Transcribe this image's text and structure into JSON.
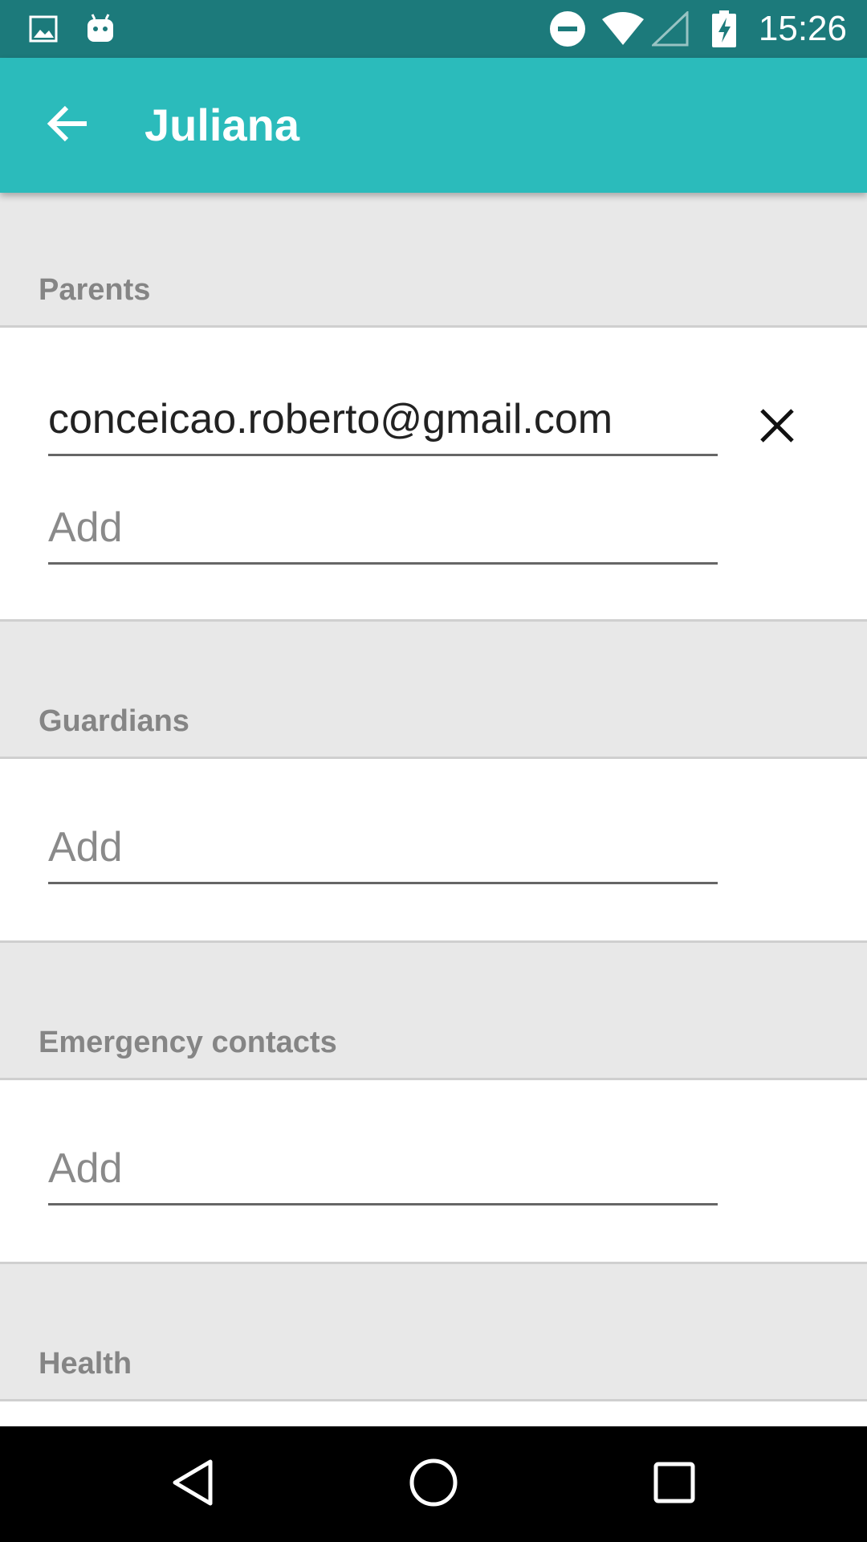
{
  "status_bar": {
    "time": "15:26",
    "icons": [
      "image-icon",
      "android-icon",
      "do-not-disturb-icon",
      "wifi-icon",
      "cellular-signal-icon",
      "battery-charging-icon"
    ]
  },
  "app_bar": {
    "title": "Juliana",
    "back_icon": "arrow-back-icon",
    "color": "#2bbbbb"
  },
  "sections": {
    "parents": {
      "header": "Parents",
      "entries": [
        "conceicao.roberto@gmail.com"
      ],
      "add_placeholder": "Add"
    },
    "guardians": {
      "header": "Guardians",
      "add_placeholder": "Add"
    },
    "emergency_contacts": {
      "header": "Emergency contacts",
      "add_placeholder": "Add"
    },
    "health": {
      "header": "Health"
    }
  },
  "nav_bar": {
    "buttons": [
      "back-triangle-icon",
      "home-circle-icon",
      "recents-square-icon"
    ]
  }
}
